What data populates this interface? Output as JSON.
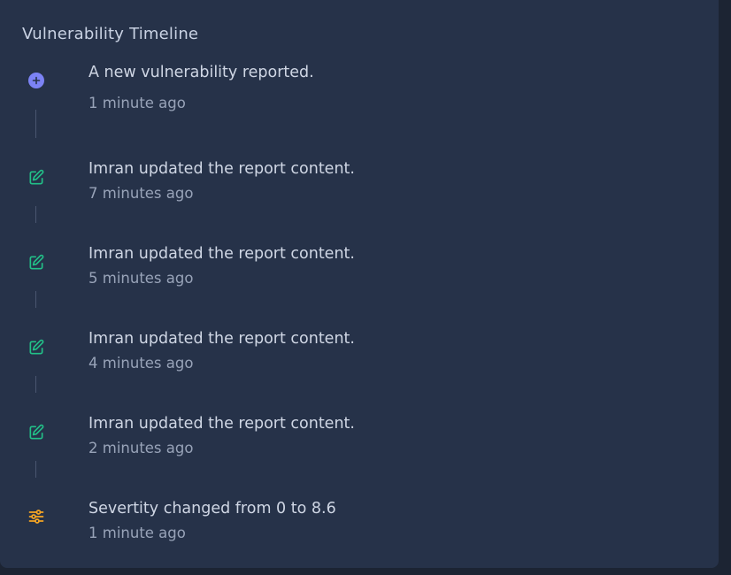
{
  "card": {
    "title": "Vulnerability Timeline"
  },
  "events": [
    {
      "text": "A new vulnerability reported.",
      "time": "1 minute ago",
      "icon": "plus-circle-icon",
      "icon_color": "#7c83f5"
    },
    {
      "text": "Imran updated the report content.",
      "time": "7 minutes ago",
      "icon": "edit-icon",
      "icon_color": "#22c088"
    },
    {
      "text": "Imran updated the report content.",
      "time": "5 minutes ago",
      "icon": "edit-icon",
      "icon_color": "#22c088"
    },
    {
      "text": "Imran updated the report content.",
      "time": "4 minutes ago",
      "icon": "edit-icon",
      "icon_color": "#22c088"
    },
    {
      "text": "Imran updated the report content.",
      "time": "2 minutes ago",
      "icon": "edit-icon",
      "icon_color": "#22c088"
    },
    {
      "text": "Severtity changed from 0 to 8.6",
      "time": "1 minute ago",
      "icon": "sliders-icon",
      "icon_color": "#f5a524"
    }
  ],
  "colors": {
    "card_background": "#263249",
    "page_background": "#1c2433",
    "connector": "#4a5670"
  }
}
